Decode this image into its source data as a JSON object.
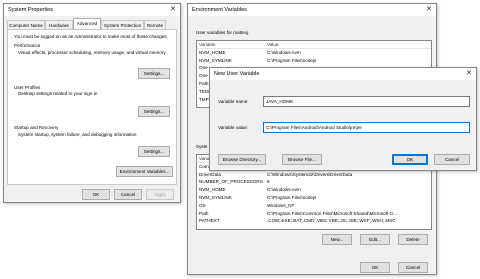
{
  "sys": {
    "title": "System Properties",
    "tabs": [
      "Computer Name",
      "Hardware",
      "Advanced",
      "System Protection",
      "Remote"
    ],
    "admin_note": "You must be logged on as an Administrator to make most of these changes.",
    "perf": {
      "title": "Performance",
      "desc": "Visual effects, processor scheduling, memory usage, and virtual memory",
      "btn": "Settings..."
    },
    "profiles": {
      "title": "User Profiles",
      "desc": "Desktop settings related to your sign-in",
      "btn": "Settings..."
    },
    "startup": {
      "title": "Startup and Recovery",
      "desc": "System startup, system failure, and debugging information",
      "btn": "Settings..."
    },
    "env_btn": "Environment Variables...",
    "ok": "OK",
    "cancel": "Cancel",
    "apply": "Apply"
  },
  "env": {
    "title": "Environment Variables",
    "user_label": "User variables for matteoj",
    "col_var": "Variable",
    "col_val": "Value",
    "user_rows": [
      [
        "NVM_HOME",
        "C:\\windows-nvm"
      ],
      [
        "NVM_SYMLINK",
        "C:\\Program Files\\nodejs"
      ],
      [
        "One",
        ""
      ],
      [
        "One",
        ""
      ],
      [
        "Path",
        ""
      ],
      [
        "TEM",
        ""
      ],
      [
        "TMP",
        ""
      ]
    ],
    "sys_label": "Syste",
    "sys_rows": [
      [
        "Varia",
        ""
      ],
      [
        "Com",
        ""
      ],
      [
        "DriverData",
        "C:\\Windows\\System32\\Drivers\\DriverData"
      ],
      [
        "NUMBER_OF_PROCESSORS",
        "8"
      ],
      [
        "NVM_HOME",
        "C:\\windows-nvm"
      ],
      [
        "NVM_SYMLINK",
        "C:\\Program Files\\nodejs"
      ],
      [
        "OS",
        "Windows_NT"
      ],
      [
        "Path",
        "C:\\Program Files\\Common Files\\Microsoft Shared\\Microsoft O..."
      ],
      [
        "PATHEXT",
        ".COM;.EXE;.BAT;.CMD;.VBS;.VBE;.JS;.JSE;.WSF;.WSH;.MSC"
      ]
    ],
    "new_btn": "New...",
    "edit_btn": "Edit...",
    "delete_btn": "Delete",
    "ok": "OK",
    "cancel": "Cancel"
  },
  "newvar": {
    "title": "New User Variable",
    "name_label": "Variable name:",
    "name_value": "JAVA_HOME",
    "value_label": "Variable value:",
    "value_value": "C:\\Program Files\\Android\\Android Studio\\jre\\jre",
    "browse_dir": "Browse Directory...",
    "browse_file": "Browse File...",
    "ok": "OK",
    "cancel": "Cancel"
  }
}
